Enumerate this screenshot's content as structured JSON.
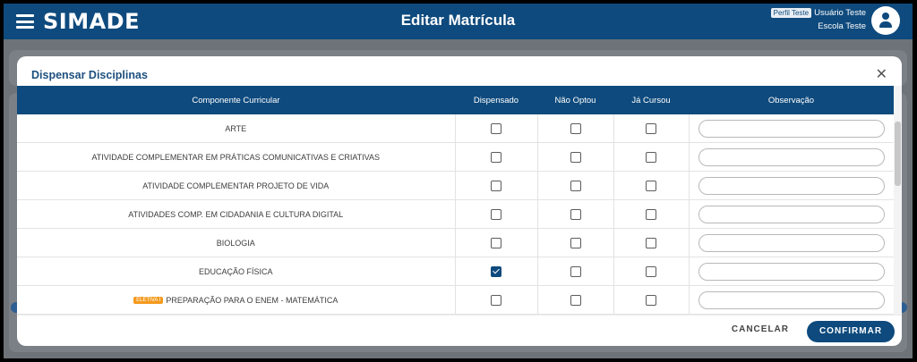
{
  "app": {
    "brand": "SIMADE",
    "page_title": "Editar Matrícula",
    "profile_badge": "Perfil Teste",
    "user_name": "Usuário Teste",
    "school_name": "Escola Teste"
  },
  "modal": {
    "title": "Dispensar Disciplinas",
    "close_icon": "close-icon",
    "columns": {
      "component": "Componente Curricular",
      "dispensed": "Dispensado",
      "not_opted": "Não Optou",
      "already_taken": "Já Cursou",
      "note": "Observação"
    },
    "rows": [
      {
        "name": "ARTE",
        "badge": "",
        "dispensado": false,
        "nao_optou": false,
        "ja_cursou": false,
        "observacao": ""
      },
      {
        "name": "ATIVIDADE COMPLEMENTAR EM PRÁTICAS COMUNICATIVAS E CRIATIVAS",
        "badge": "",
        "dispensado": false,
        "nao_optou": false,
        "ja_cursou": false,
        "observacao": ""
      },
      {
        "name": "ATIVIDADE COMPLEMENTAR PROJETO DE VIDA",
        "badge": "",
        "dispensado": false,
        "nao_optou": false,
        "ja_cursou": false,
        "observacao": ""
      },
      {
        "name": "ATIVIDADES COMP. EM CIDADANIA E CULTURA DIGITAL",
        "badge": "",
        "dispensado": false,
        "nao_optou": false,
        "ja_cursou": false,
        "observacao": ""
      },
      {
        "name": "BIOLOGIA",
        "badge": "",
        "dispensado": false,
        "nao_optou": false,
        "ja_cursou": false,
        "observacao": ""
      },
      {
        "name": "EDUCAÇÃO FÍSICA",
        "badge": "",
        "dispensado": true,
        "nao_optou": false,
        "ja_cursou": false,
        "observacao": ""
      },
      {
        "name": "PREPARAÇÃO PARA O ENEM - MATEMÁTICA",
        "badge": "ELETIVA I",
        "dispensado": false,
        "nao_optou": false,
        "ja_cursou": false,
        "observacao": ""
      }
    ],
    "cancel_label": "CANCELAR",
    "confirm_label": "CONFIRMAR"
  },
  "colors": {
    "primary": "#0e4a7d",
    "overlay": "#6d7379",
    "badge_eletiva": "#f39a1e"
  }
}
